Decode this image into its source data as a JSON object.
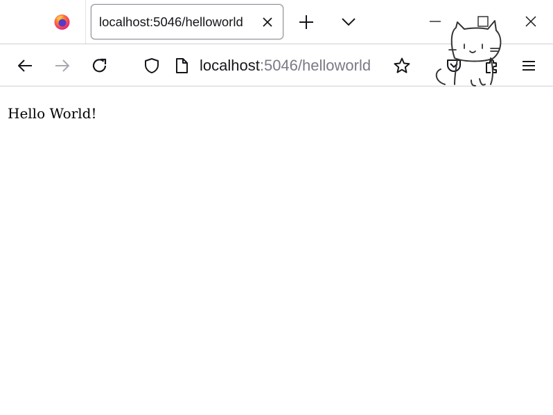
{
  "tab": {
    "title": "localhost:5046/helloworld"
  },
  "urlbar": {
    "host": "localhost",
    "path": ":5046/helloworld"
  },
  "page": {
    "body_text": "Hello World!"
  },
  "icons": {
    "browser_logo": "firefox-icon",
    "tab_close": "close-icon",
    "new_tab": "plus-icon",
    "tab_list": "chevron-down-icon",
    "minimize": "minimize-icon",
    "maximize": "maximize-icon",
    "window_close": "close-icon",
    "back": "arrow-left-icon",
    "forward": "arrow-right-icon",
    "reload": "reload-icon",
    "tracking_protection": "shield-icon",
    "page_info": "page-icon",
    "bookmark": "star-icon",
    "pocket": "pocket-icon",
    "extensions": "puzzle-icon",
    "menu": "hamburger-menu-icon",
    "decoration": "cat-drawing-icon"
  },
  "colors": {
    "text": "#15141a",
    "url_path": "#7a7a85",
    "disabled_icon": "#a8a8b0",
    "border": "#cfcfd8"
  }
}
